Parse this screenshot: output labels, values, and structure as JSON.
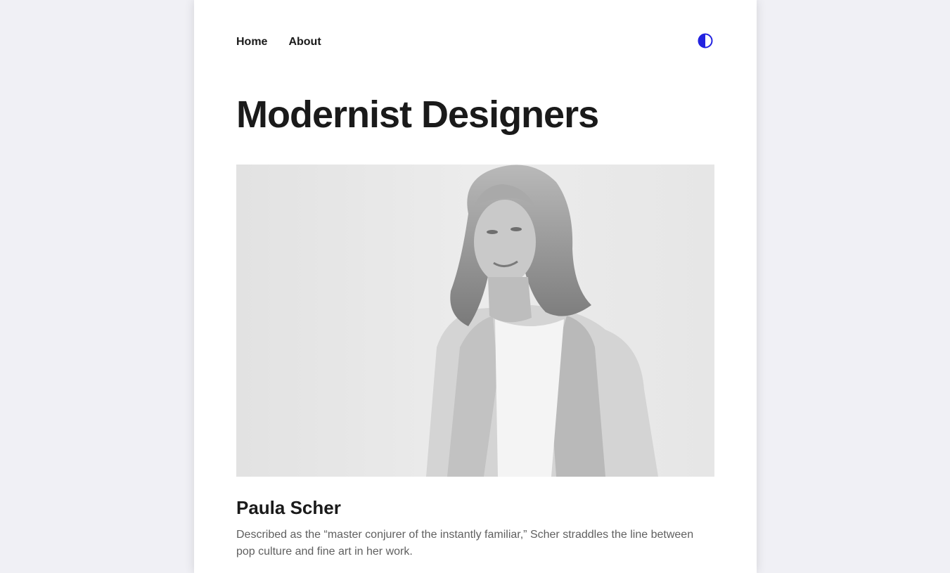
{
  "nav": {
    "items": [
      {
        "label": "Home"
      },
      {
        "label": "About"
      }
    ]
  },
  "theme_toggle": {
    "icon": "contrast-half-circle-icon",
    "color": "#2323e0"
  },
  "page": {
    "title": "Modernist Designers"
  },
  "post": {
    "image": {
      "subject": "designer-portrait",
      "tone": "grayscale"
    },
    "title": "Paula Scher",
    "excerpt": "Described as the “master conjurer of the instantly familiar,” Scher straddles the line between pop culture and fine art in her work."
  }
}
